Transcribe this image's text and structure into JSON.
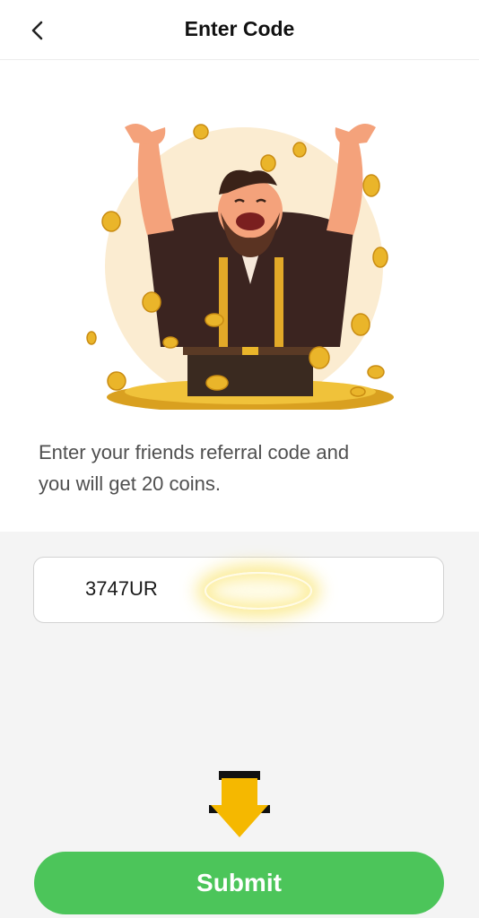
{
  "header": {
    "title": "Enter Code",
    "back_icon": "chevron-left-icon"
  },
  "illustration": {
    "subject": "cheering-man-with-gold-coins"
  },
  "description": {
    "line1": "Enter your friends referral code and",
    "line2": "you will get 20 coins."
  },
  "code_input": {
    "value": "3747UR"
  },
  "submit": {
    "label": "Submit"
  },
  "colors": {
    "accent": "#4cc55a",
    "coin": "#e8b020",
    "arrow": "#f5b800"
  }
}
